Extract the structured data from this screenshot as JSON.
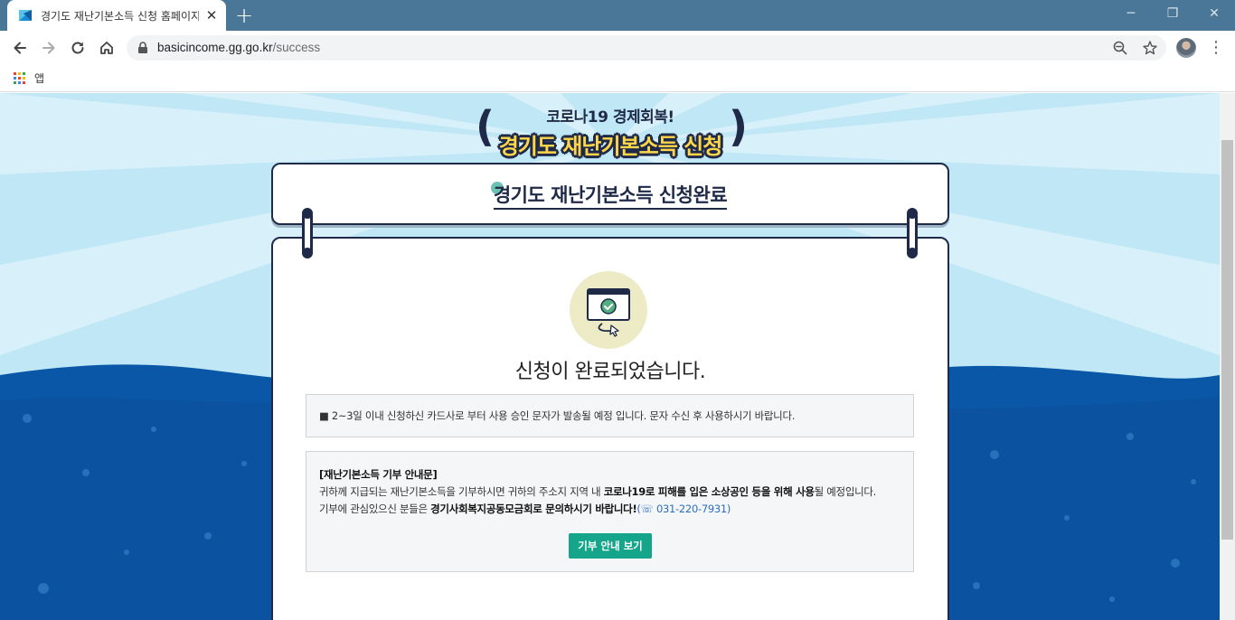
{
  "browser": {
    "tab_title": "경기도 재난기본소득 신청 홈페이지",
    "tab_close": "✕",
    "new_tab": "+",
    "url_host": "basicincome.gg.go.kr",
    "url_path": "/success",
    "bookmarks_apps_label": "앱",
    "window_controls": {
      "minimize": "─",
      "restore": "❐",
      "close": "✕"
    },
    "menu_glyph": "⋮"
  },
  "page": {
    "header_small": "코로나19 경제회복!",
    "header_big": "경기도 재난기본소득 신청",
    "paren_left": "(",
    "paren_right": ")",
    "sign_title": "경기도 재난기본소득 신청완료",
    "complete_message": "신청이 완료되었습니다.",
    "notice_text": "■ 2~3일 이내 신청하신 카드사로 부터 사용 승인 문자가 발송될 예정 입니다. 문자 수신 후 사용하시기 바랍니다.",
    "donation": {
      "heading": "[재난기본소득 기부 안내문]",
      "line1_a": "귀하께 지급되는 재난기본소득을 기부하시면 귀하의 주소지 지역 내 ",
      "line1_b": "코로나19로 피해를 입은 소상공인 등을 위해 사용",
      "line1_c": "될 예정입니다.",
      "line2_a": "기부에 관심있으신 분들은 ",
      "line2_b": "경기사회복지공동모금회로 문의하시기 바랍니다!",
      "phone": "(☏ 031-220-7931)",
      "button_label": "기부 안내 보기"
    }
  },
  "colors": {
    "tabstrip": "#4a7797",
    "sky": "#bfe7f6",
    "sea": "#0a57a8",
    "navy": "#1e2a48",
    "accent_green": "#14a58a",
    "title_yellow": "#ffd64a"
  },
  "icons": [
    "favicon-icon",
    "back-arrow-icon",
    "forward-arrow-icon",
    "reload-icon",
    "home-icon",
    "lock-icon",
    "zoom-out-icon",
    "star-icon",
    "apps-grid-icon",
    "monitor-check-icon"
  ]
}
